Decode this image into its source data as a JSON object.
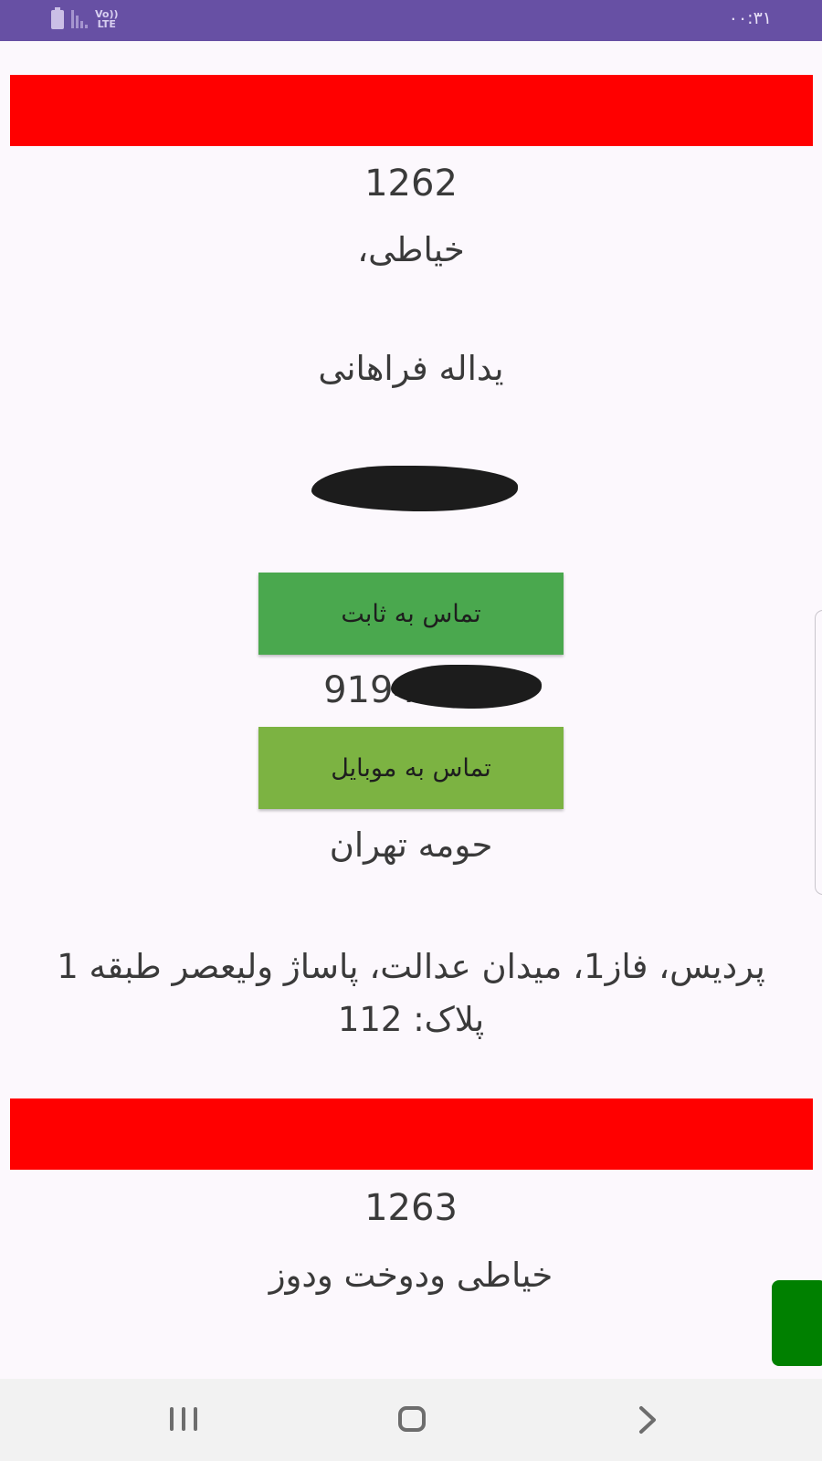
{
  "status_bar": {
    "time": "۰۰:۳۱",
    "network_label": "Vo))\nLTE"
  },
  "cards": [
    {
      "id": "1262",
      "category": "خیاطی،",
      "name": "یداله فراهانی",
      "landline": "",
      "call_landline_label": "تماس به ثابت",
      "mobile": "9194",
      "call_mobile_label": "تماس به موبایل",
      "region": "حومه تهران",
      "address": "پردیس، فاز1، میدان عدالت، پاساژ ولیعصر طبقه 1 پلاک: 112"
    },
    {
      "id": "1263",
      "category": "خیاطی ودوخت ودوز"
    }
  ],
  "colors": {
    "status_bar": "#6750a4",
    "card_header": "#ff0000",
    "call_landline": "#4aa84e",
    "call_mobile": "#7cb342",
    "fab": "#008000",
    "background": "#fcf8fd"
  },
  "nav_bar": {
    "icons": [
      "recent-apps-icon",
      "home-icon",
      "back-icon"
    ]
  }
}
